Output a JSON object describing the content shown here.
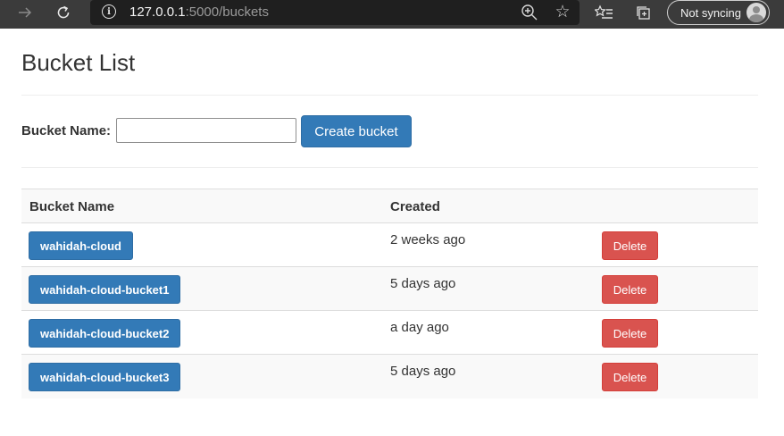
{
  "browser": {
    "url_host": "127.0.0.1",
    "url_path": ":5000/buckets",
    "profile_label": "Not syncing",
    "icons": {
      "forward": "arrow-right-icon",
      "refresh": "refresh-icon",
      "info": "info-icon",
      "zoom": "zoom-in-icon",
      "favorite": "star-icon",
      "favorites_list": "favorites-list-icon",
      "collections": "collections-icon",
      "avatar": "person-avatar-icon"
    }
  },
  "page": {
    "title": "Bucket List"
  },
  "form": {
    "label": "Bucket Name:",
    "input_value": "",
    "create_label": "Create bucket"
  },
  "table": {
    "headers": [
      "Bucket Name",
      "Created",
      ""
    ],
    "rows": [
      {
        "name": "wahidah-cloud",
        "created": "2 weeks ago",
        "action": "Delete"
      },
      {
        "name": "wahidah-cloud-bucket1",
        "created": "5 days ago",
        "action": "Delete"
      },
      {
        "name": "wahidah-cloud-bucket2",
        "created": "a day ago",
        "action": "Delete"
      },
      {
        "name": "wahidah-cloud-bucket3",
        "created": "5 days ago",
        "action": "Delete"
      }
    ]
  },
  "colors": {
    "primary": "#337ab7",
    "danger": "#d9534f",
    "chrome": "#3b3b3b"
  }
}
